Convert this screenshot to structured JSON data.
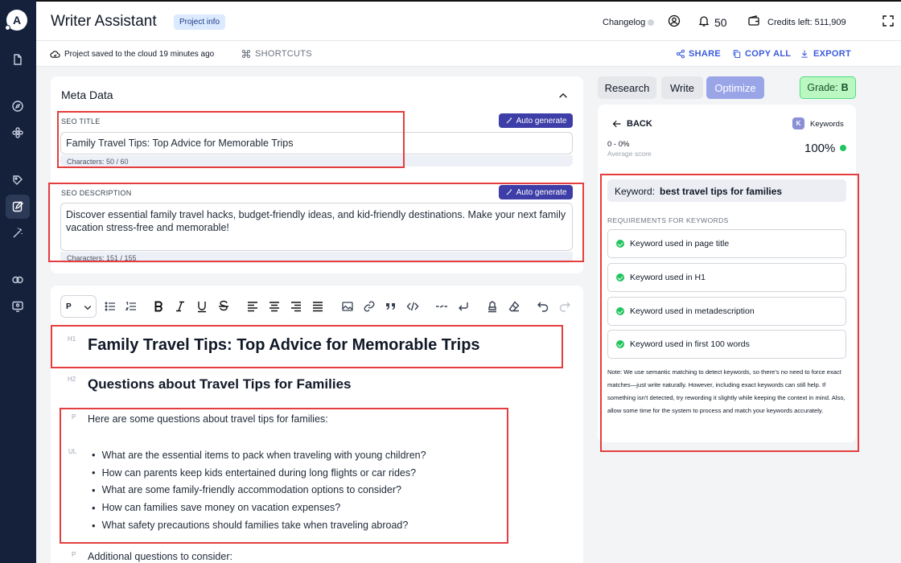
{
  "sidebar": {
    "logo_letter": "A",
    "icons": [
      "document-icon",
      "compass-icon",
      "flower-icon",
      "tag-edit-icon",
      "edit-icon",
      "magic-wand-icon",
      "link-icon",
      "monitor-icon"
    ]
  },
  "header": {
    "title": "Writer Assistant",
    "project_info": "Project info",
    "changelog": "Changelog",
    "notifications": "50",
    "credits": "Credits left: 511,909"
  },
  "subbar": {
    "saved": "Project saved to the cloud 19 minutes ago",
    "shortcuts": "SHORTCUTS",
    "share": "SHARE",
    "copy_all": "COPY ALL",
    "export": "EXPORT"
  },
  "meta": {
    "title": "Meta Data",
    "seo_title_label": "SEO TITLE",
    "auto_generate": "Auto generate",
    "seo_title_value": "Family Travel Tips: Top Advice for Memorable Trips",
    "seo_title_chars": "Characters: 50 / 60",
    "seo_desc_label": "SEO DESCRIPTION",
    "seo_desc_value": "Discover essential family travel hacks, budget-friendly ideas, and kid-friendly destinations. Make your next family vacation stress-free and memorable!",
    "seo_desc_chars": "Characters: 151 / 155"
  },
  "editor": {
    "block_type": "P",
    "tags": {
      "h1": "H1",
      "h2": "H2",
      "p": "P",
      "ul": "UL"
    },
    "h1": "Family Travel Tips: Top Advice for Memorable Trips",
    "h2": "Questions about Travel Tips for Families",
    "intro": "Here are some questions about travel tips for families:",
    "list": [
      "What are the essential items to pack when traveling with young children?",
      "How can parents keep kids entertained during long flights or car rides?",
      "What are some family-friendly accommodation options to consider?",
      "How can families save money on vacation expenses?",
      "What safety precautions should families take when traveling abroad?"
    ],
    "additional": "Additional questions to consider:"
  },
  "panel": {
    "tabs": [
      "Research",
      "Write",
      "Optimize"
    ],
    "grade_label": "Grade:",
    "grade_value": "B",
    "back": "BACK",
    "kw_badge": "K",
    "kw_label": "Keywords",
    "range": "0 - 0%",
    "avg": "Average score",
    "percent": "100%",
    "keyword_label": "Keyword:",
    "keyword_value": "best travel tips for families",
    "req_head": "REQUIREMENTS FOR KEYWORDS",
    "requirements": [
      "Keyword used in page title",
      "Keyword used in H1",
      "Keyword used in metadescription",
      "Keyword used in first 100 words"
    ],
    "note": "Note: We use semantic matching to detect keywords, so there's no need to force exact matches—just write naturally. However, including exact keywords can still help. If something isn't detected, try rewording it slightly while keeping the context in mind. Also, allow some time for the system to process and match your keywords accurately."
  },
  "colors": {
    "sidebar": "#15213b",
    "accent": "#3e3ea8",
    "highlight": "#e53e3e",
    "success": "#22c55e"
  }
}
